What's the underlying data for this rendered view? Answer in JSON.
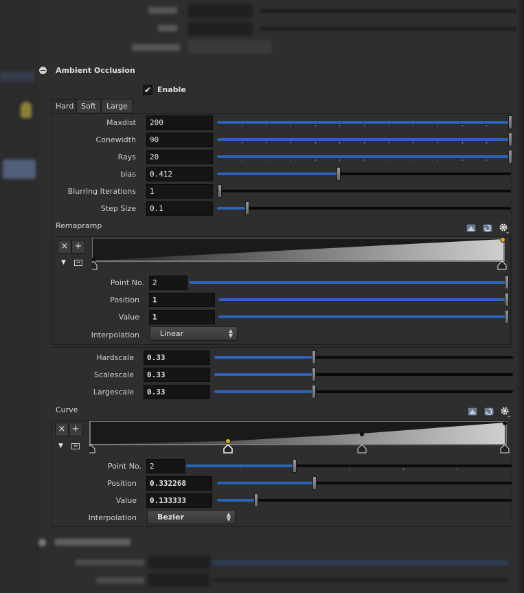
{
  "ao": {
    "title": "Ambient Occlusion",
    "enable_label": "Enable",
    "tabs": [
      "Hard",
      "Soft",
      "Large"
    ],
    "params": [
      {
        "label": "Maxdist",
        "value": "200",
        "fill": 1.0
      },
      {
        "label": "Conewidth",
        "value": "90",
        "fill": 1.0
      },
      {
        "label": "Rays",
        "value": "20",
        "fill": 1.0
      },
      {
        "label": "bias",
        "value": "0.412",
        "fill": 0.412
      },
      {
        "label": "Blurring Iterations",
        "value": "1",
        "fill": 0.0
      },
      {
        "label": "Step Size",
        "value": "0.1",
        "fill": 0.1
      }
    ],
    "remapramp": {
      "label": "Remapramp",
      "remove_label": "×",
      "add_label": "+",
      "point_no_label": "Point No.",
      "point_no": "2",
      "position_label": "Position",
      "position": "1",
      "value_label": "Value",
      "value": "1",
      "interp_label": "Interpolation",
      "interp": "Linear"
    },
    "scales": [
      {
        "label": "Hardscale",
        "value": "0.33",
        "fill": 0.33
      },
      {
        "label": "Scalescale",
        "value": "0.33",
        "fill": 0.33
      },
      {
        "label": "Largescale",
        "value": "0.33",
        "fill": 0.33
      }
    ],
    "curve": {
      "label": "Curve",
      "remove_label": "×",
      "add_label": "+",
      "point_no_label": "Point No.",
      "point_no": "2",
      "position_label": "Position",
      "position": "0.332268",
      "value_label": "Value",
      "value": "0.133333",
      "interp_label": "Interpolation",
      "interp": "Bezier"
    }
  },
  "colors": {
    "accent": "#2c63b8",
    "selected_key": "#e0b020"
  }
}
